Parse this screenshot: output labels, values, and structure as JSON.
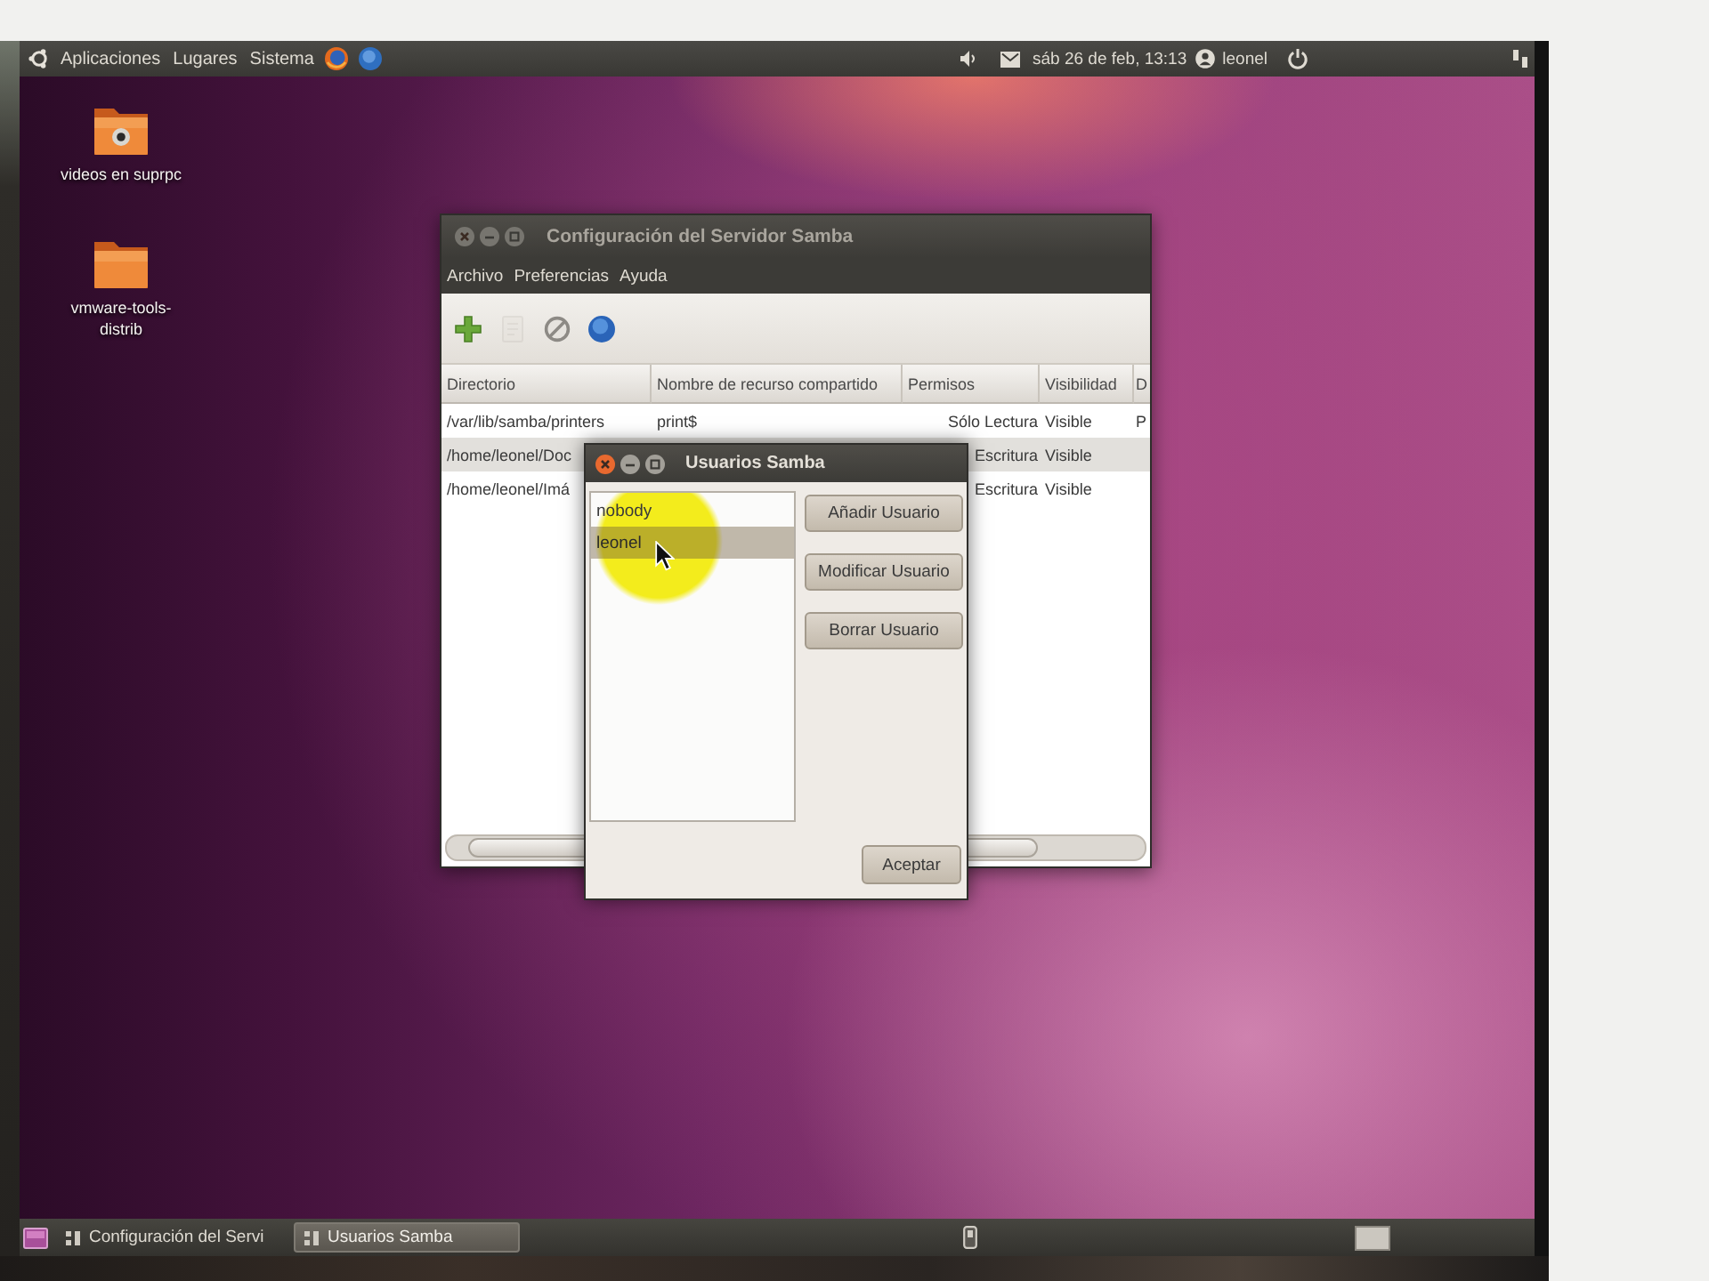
{
  "top_panel": {
    "menus": [
      "Aplicaciones",
      "Lugares",
      "Sistema"
    ],
    "clock": "sáb 26 de feb, 13:13",
    "user": "leonel"
  },
  "desktop_icons": [
    {
      "label": "videos en suprpc",
      "emblem": true
    },
    {
      "label": "vmware-tools-distrib",
      "emblem": false
    }
  ],
  "main_window": {
    "title": "Configuración del Servidor Samba",
    "focused": false,
    "menu": [
      "Archivo",
      "Preferencias",
      "Ayuda"
    ],
    "toolbar": [
      {
        "kind": "add",
        "disabled": false
      },
      {
        "kind": "properties",
        "disabled": true
      },
      {
        "kind": "delete",
        "disabled": false
      },
      {
        "kind": "help",
        "disabled": false
      }
    ],
    "table": {
      "columns": [
        "Directorio",
        "Nombre de recurso compartido",
        "Permisos",
        "Visibilidad",
        "D"
      ],
      "rows": [
        {
          "cells": [
            "/var/lib/samba/printers",
            "print$",
            "Sólo Lectura",
            "Visible",
            "P"
          ],
          "selected": false
        },
        {
          "cells": [
            "/home/leonel/Doc",
            null,
            "Escritura",
            "Visible",
            null
          ],
          "selected": true
        },
        {
          "cells": [
            "/home/leonel/Imá",
            null,
            "Escritura",
            "Visible",
            null
          ],
          "selected": false
        }
      ]
    }
  },
  "dialog": {
    "title": "Usuarios Samba",
    "focused": true,
    "users": [
      {
        "name": "nobody",
        "selected": false
      },
      {
        "name": "leonel",
        "selected": true
      }
    ],
    "buttons": [
      "Añadir Usuario",
      "Modificar Usuario",
      "Borrar Usuario"
    ],
    "ok_button": "Aceptar"
  },
  "taskbar": [
    {
      "label": "Configuración del Servi",
      "selected": false
    },
    {
      "label": "Usuarios Samba",
      "selected": true
    }
  ]
}
